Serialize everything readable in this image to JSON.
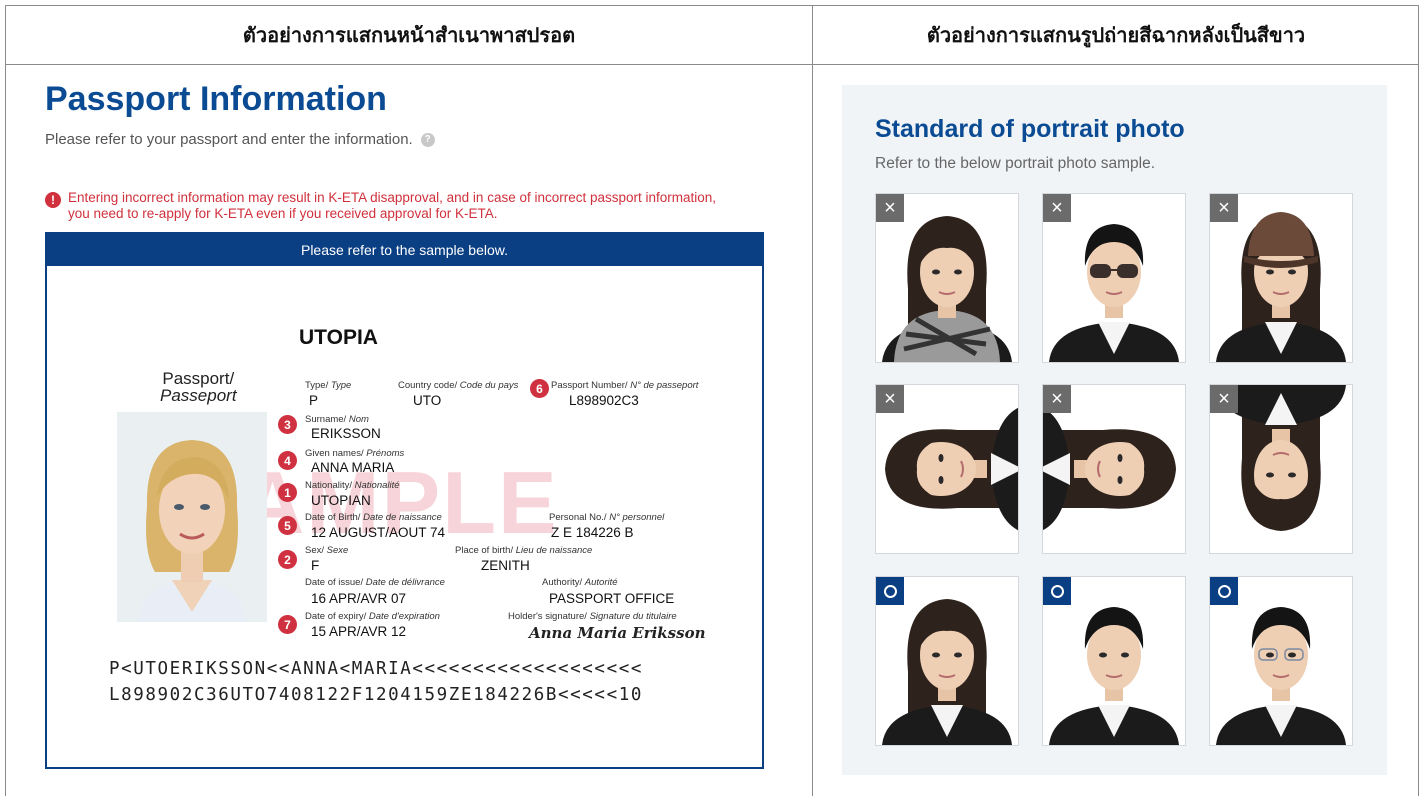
{
  "header": {
    "left_title": "ตัวอย่างการแสกนหน้าสำเนาพาสปรอต",
    "right_title": "ตัวอย่างการแสกนรูปถ่ายสีฉากหลังเป็นสีขาว"
  },
  "passport_info": {
    "title": "Passport Information",
    "subtitle": "Please refer to your passport and enter the information.",
    "warning_line1": "Entering incorrect information may result in K-ETA disapproval, and in case of incorrect passport information,",
    "warning_line2": "you need to re-apply for K-ETA even if you received approval for K-ETA.",
    "sample_bar": "Please refer to the sample below."
  },
  "passport": {
    "country": "UTOPIA",
    "doc_label_1": "Passport/",
    "doc_label_2": "Passeport",
    "watermark": "SAMPLE",
    "type_label": "Type/ ",
    "type_label_fr": "Type",
    "type_value": "P",
    "country_code_label": "Country code/ ",
    "country_code_label_fr": "Code du pays",
    "country_code_value": "UTO",
    "passport_no_label": "Passport Number/ ",
    "passport_no_label_fr": "N° de passeport",
    "passport_no_value": "L898902C3",
    "surname_label": "Surname/ ",
    "surname_label_fr": "Nom",
    "surname_value": "ERIKSSON",
    "given_label": "Given names/ ",
    "given_label_fr": "Prénoms",
    "given_value": "ANNA MARIA",
    "nationality_label": "Nationality/ ",
    "nationality_label_fr": "Nationalité",
    "nationality_value": "UTOPIAN",
    "dob_label": "Date of Birth/ ",
    "dob_label_fr": "Date de naissance",
    "dob_value": "12 AUGUST/AOUT 74",
    "personal_no_label": "Personal No./ ",
    "personal_no_label_fr": "N° personnel",
    "personal_no_value": "Z E 184226 B",
    "sex_label": "Sex/ ",
    "sex_label_fr": "Sexe",
    "sex_value": "F",
    "pob_label": "Place of birth/ ",
    "pob_label_fr": "Lieu de naissance",
    "pob_value": "ZENITH",
    "issue_label": "Date of issue/ ",
    "issue_label_fr": "Date de délivrance",
    "issue_value": "16 APR/AVR 07",
    "authority_label": "Authority/ ",
    "authority_label_fr": "Autorité",
    "authority_value": "PASSPORT OFFICE",
    "expiry_label": "Date of expiry/ ",
    "expiry_label_fr": "Date d'expiration",
    "expiry_value": "15 APR/AVR 12",
    "signature_label": "Holder's signature/ ",
    "signature_label_fr": "Signature du titulaire",
    "signature_value": "Anna Maria Eriksson",
    "markers": {
      "nationality": "1",
      "sex": "2",
      "surname": "3",
      "given": "4",
      "dob": "5",
      "passport_no": "6",
      "expiry": "7"
    },
    "mrz_line1": "P<UTOERIKSSON<<ANNA<MARIA<<<<<<<<<<<<<<<<<<<",
    "mrz_line2": "L898902C36UTO7408122F1204159ZE184226B<<<<<10"
  },
  "portrait": {
    "title": "Standard of portrait photo",
    "subtitle": "Refer to the below portrait photo sample.",
    "photos": [
      {
        "status": "incorrect",
        "mark": "×",
        "variant": "scarf"
      },
      {
        "status": "incorrect",
        "mark": "×",
        "variant": "sunglasses"
      },
      {
        "status": "incorrect",
        "mark": "×",
        "variant": "cap"
      },
      {
        "status": "incorrect",
        "mark": "×",
        "variant": "rotated-left"
      },
      {
        "status": "incorrect",
        "mark": "×",
        "variant": "rotated-right"
      },
      {
        "status": "incorrect",
        "mark": "×",
        "variant": "upside-down"
      },
      {
        "status": "correct",
        "variant": "woman"
      },
      {
        "status": "correct",
        "variant": "man"
      },
      {
        "status": "correct",
        "variant": "man-glasses"
      }
    ]
  },
  "colors": {
    "brand_blue": "#0a3f84",
    "title_blue": "#0b4b93",
    "warning_red": "#d0313c",
    "marker_red": "#cf3140",
    "incorrect_gray": "#6b6b6b"
  }
}
